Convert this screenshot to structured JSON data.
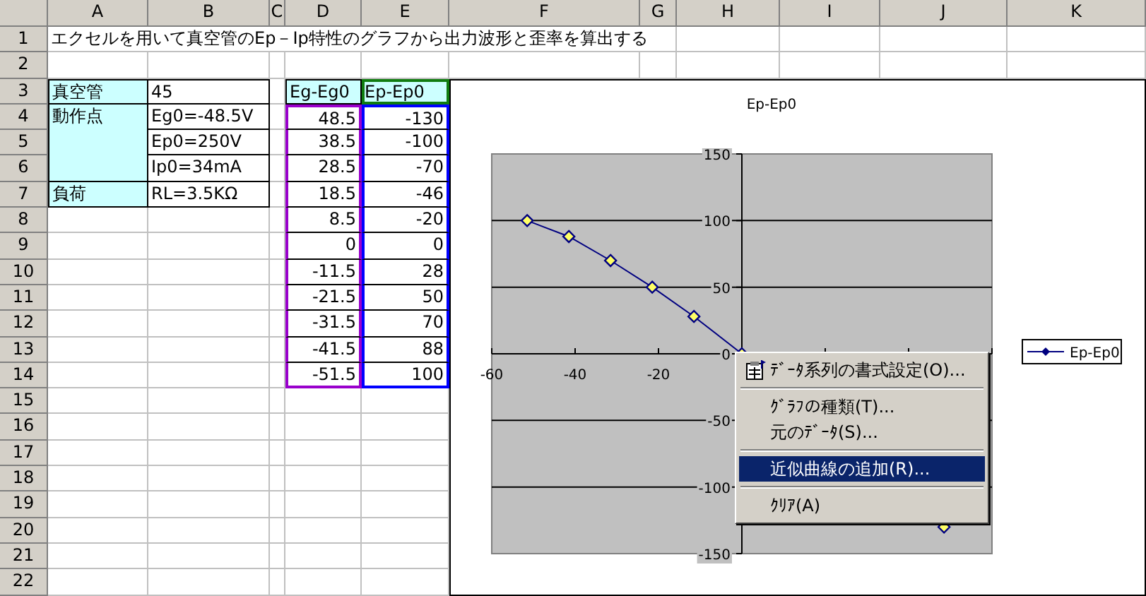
{
  "sheet": {
    "column_headers": [
      "A",
      "B",
      "C",
      "D",
      "E",
      "F",
      "G",
      "H",
      "I",
      "J",
      "K"
    ],
    "row_headers": [
      "1",
      "2",
      "3",
      "4",
      "5",
      "6",
      "7",
      "8",
      "9",
      "10",
      "11",
      "12",
      "13",
      "14",
      "15",
      "16",
      "17",
      "18",
      "19",
      "20",
      "21",
      "22"
    ],
    "title_cell": "エクセルを用いて真空管のEp－Ip特性のグラフから出力波形と歪率を算出する",
    "spec_table": [
      {
        "label": "真空管",
        "values": [
          "45"
        ]
      },
      {
        "label": "動作点",
        "values": [
          "Eg0=-48.5V",
          "Ep0=250V",
          "Ip0=34mA"
        ]
      },
      {
        "label": "負荷",
        "values": [
          "RL=3.5KΩ"
        ]
      }
    ],
    "data_table": [
      {
        "header": "Eg-Eg0",
        "selected": false,
        "color": "#9900cc",
        "values": [
          "48.5",
          "38.5",
          "28.5",
          "18.5",
          "8.5",
          "0",
          "-11.5",
          "-21.5",
          "-31.5",
          "-41.5",
          "-51.5"
        ]
      },
      {
        "header": "Ep-Ep0",
        "selected": true,
        "color": "#0000ff",
        "values": [
          "-130",
          "-100",
          "-70",
          "-46",
          "-20",
          "0",
          "28",
          "50",
          "70",
          "88",
          "100"
        ]
      }
    ]
  },
  "chart": {
    "chart_data": {
      "type": "line",
      "title": "Ep-Ep0",
      "x": [
        48.5,
        0,
        -11.5,
        -21.5,
        -31.5,
        -41.5,
        -51.5
      ],
      "series": [
        {
          "name": "Ep-Ep0",
          "color": "#000080",
          "marker": "diamond",
          "values": [
            -130,
            0,
            28,
            50,
            70,
            88,
            100
          ]
        }
      ],
      "xlim": [
        -60,
        60
      ],
      "ylim": [
        -150,
        150
      ],
      "grid": true,
      "xticks": [
        -60,
        -40,
        -20
      ],
      "yticks": [
        -150,
        -100,
        -50,
        0,
        50,
        100,
        150
      ]
    }
  },
  "context_menu": {
    "items": [
      {
        "kind": "icon_item",
        "label": "ﾃﾞｰﾀ系列の書式設定(O)...",
        "selected": false
      },
      {
        "kind": "separator"
      },
      {
        "kind": "item",
        "label": "ｸﾞﾗﾌの種類(T)...",
        "selected": false
      },
      {
        "kind": "item",
        "label": "元のﾃﾞｰﾀ(S)...",
        "selected": false
      },
      {
        "kind": "separator"
      },
      {
        "kind": "item",
        "label": "近似曲線の追加(R)...",
        "selected": true
      },
      {
        "kind": "separator"
      },
      {
        "kind": "item",
        "label": "ｸﾘｱ(A)",
        "selected": false
      }
    ]
  }
}
